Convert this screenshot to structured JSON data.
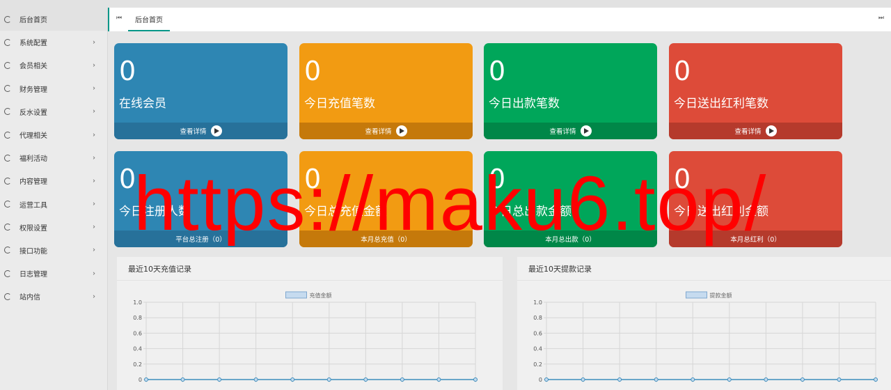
{
  "sidebar": {
    "items": [
      {
        "label": "后台首页",
        "arrow": ""
      },
      {
        "label": "系统配置",
        "arrow": "›"
      },
      {
        "label": "会员相关",
        "arrow": "›"
      },
      {
        "label": "财务管理",
        "arrow": "›"
      },
      {
        "label": "反水设置",
        "arrow": "›"
      },
      {
        "label": "代理相关",
        "arrow": "›"
      },
      {
        "label": "福利活动",
        "arrow": "›"
      },
      {
        "label": "内容管理",
        "arrow": "›"
      },
      {
        "label": "运营工具",
        "arrow": "›"
      },
      {
        "label": "权限设置",
        "arrow": "›"
      },
      {
        "label": "接口功能",
        "arrow": "›"
      },
      {
        "label": "日志管理",
        "arrow": "›"
      },
      {
        "label": "站内信",
        "arrow": "›"
      }
    ]
  },
  "tabs": {
    "prev_icon": "⏮",
    "next_icon": "⏭",
    "active": "后台首页"
  },
  "cards": [
    {
      "number": "0",
      "label": "在线会员",
      "footer": "查看详情"
    },
    {
      "number": "0",
      "label": "今日充值笔数",
      "footer": "查看详情"
    },
    {
      "number": "0",
      "label": "今日出款笔数",
      "footer": "查看详情"
    },
    {
      "number": "0",
      "label": "今日送出红利笔数",
      "footer": "查看详情"
    },
    {
      "number": "0",
      "label": "今日注册人数",
      "footer": "平台总注册（0）"
    },
    {
      "number": "0",
      "label": "今日总充值金额",
      "footer": "本月总充值（0）"
    },
    {
      "number": "0",
      "label": "今日总出款金额",
      "footer": "本月总出款（0）"
    },
    {
      "number": "0",
      "label": "今日送出红利金额",
      "footer": "本月总红利（0）"
    }
  ],
  "watermark": "https://maku6.top/",
  "panels": [
    {
      "title": "最近10天充值记录"
    },
    {
      "title": "最近10天提款记录"
    }
  ],
  "chart_data": [
    {
      "type": "line",
      "series": [
        {
          "name": "充值金额",
          "values": [
            0,
            0,
            0,
            0,
            0,
            0,
            0,
            0,
            0,
            0
          ]
        }
      ],
      "ylim": [
        0,
        1.0
      ],
      "yticks": [
        "1.0",
        "0.8",
        "0.6",
        "0.4",
        "0.2",
        "0"
      ],
      "grid": true,
      "legend": "top-center",
      "color": "#3c8dbc"
    },
    {
      "type": "line",
      "series": [
        {
          "name": "提款金额",
          "values": [
            0,
            0,
            0,
            0,
            0,
            0,
            0,
            0,
            0,
            0
          ]
        }
      ],
      "ylim": [
        0,
        1.0
      ],
      "yticks": [
        "1.0",
        "0.8",
        "0.6",
        "0.4",
        "0.2",
        "0"
      ],
      "grid": true,
      "legend": "top-center",
      "color": "#3c8dbc"
    }
  ]
}
